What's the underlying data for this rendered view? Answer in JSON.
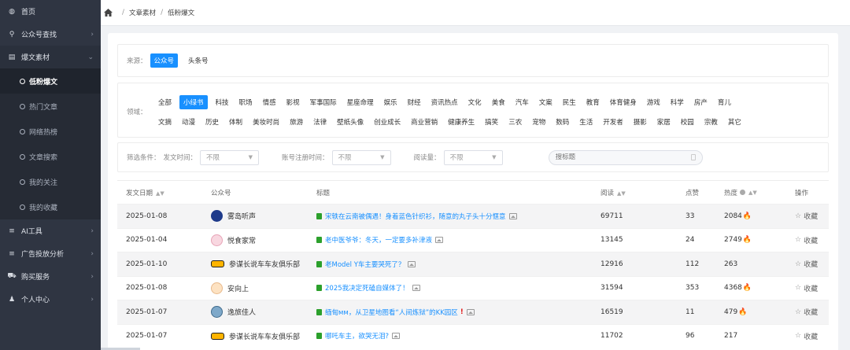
{
  "sidebar": {
    "items": [
      {
        "label": "首页",
        "icon": "dashboard-icon"
      },
      {
        "label": "公众号查找",
        "icon": "search-icon"
      },
      {
        "label": "爆文素材",
        "icon": "document-icon"
      }
    ],
    "submenu": [
      {
        "label": "低粉爆文",
        "active": true
      },
      {
        "label": "热门文章"
      },
      {
        "label": "网络热榜"
      },
      {
        "label": "文章搜索"
      },
      {
        "label": "我的关注"
      },
      {
        "label": "我的收藏"
      }
    ],
    "items_bottom": [
      {
        "label": "AI工具",
        "icon": "list-icon"
      },
      {
        "label": "广告投放分析",
        "icon": "list-icon"
      },
      {
        "label": "购买服务",
        "icon": "cart-icon"
      },
      {
        "label": "个人中心",
        "icon": "user-icon"
      }
    ]
  },
  "breadcrumb": [
    "文章素材",
    "低粉爆文"
  ],
  "source": {
    "label": "来源：",
    "options": [
      "公众号",
      "头条号"
    ],
    "selected": "公众号"
  },
  "domain": {
    "label": "领域：",
    "row1": [
      "全部",
      "小绿书",
      "科技",
      "职场",
      "情感",
      "影视",
      "军事国际",
      "星座命理",
      "娱乐",
      "财经",
      "资讯热点",
      "文化",
      "美食",
      "汽车",
      "文案",
      "民生",
      "教育",
      "体育健身",
      "游戏",
      "科学",
      "房产",
      "育儿"
    ],
    "row2": [
      "文摘",
      "动漫",
      "历史",
      "体制",
      "美妆时尚",
      "旅游",
      "法律",
      "壁纸头像",
      "创业成长",
      "商业营销",
      "健康养生",
      "搞笑",
      "三农",
      "宠物",
      "数码",
      "生活",
      "开发者",
      "摄影",
      "家居",
      "校园",
      "宗教",
      "其它"
    ],
    "selected": "小绿书"
  },
  "filters": {
    "label": "筛选条件：",
    "publish_label": "发文时间：",
    "publish_value": "不限",
    "register_label": "账号注册时间：",
    "register_value": "不限",
    "read_label": "阅读量：",
    "read_value": "不限",
    "search_placeholder": "搜标题"
  },
  "table": {
    "headers": {
      "date": "发文日期",
      "account": "公众号",
      "title": "标题",
      "reads": "阅读",
      "likes": "点赞",
      "heat": "热度",
      "action": "操作"
    },
    "rows": [
      {
        "date": "2025-01-08",
        "account": "雾岛听声",
        "avatar": "blue",
        "title": "宋轶在云南被偶遇！身着蓝色针织衫，随意的丸子头十分惬意",
        "reads": "69711",
        "likes": "33",
        "heat": "2084",
        "fire": true,
        "action": "收藏"
      },
      {
        "date": "2025-01-04",
        "account": "悦食家常",
        "avatar": "pink",
        "title": "老中医爷爷：冬天，一定要多补津液",
        "reads": "13145",
        "likes": "24",
        "heat": "2749",
        "fire": true,
        "action": "收藏"
      },
      {
        "date": "2025-01-10",
        "account": "参谋长说车车友俱乐部",
        "avatar": "car",
        "title": "老Model Y车主要哭死了？",
        "reads": "12916",
        "likes": "112",
        "heat": "263",
        "fire": false,
        "action": "收藏"
      },
      {
        "date": "2025-01-08",
        "account": "安向上",
        "avatar": "person",
        "title": "2025我决定死磕自媒体了！",
        "reads": "31594",
        "likes": "353",
        "heat": "4368",
        "fire": true,
        "action": "收藏"
      },
      {
        "date": "2025-01-07",
        "account": "逸旅佳人",
        "avatar": "planet",
        "title": "缅甸ᴍᴍ，从卫星地图看“人间炼狱”的KK园区",
        "excl": "!",
        "reads": "16519",
        "likes": "11",
        "heat": "479",
        "fire": true,
        "action": "收藏"
      },
      {
        "date": "2025-01-07",
        "account": "参谋长说车车友俱乐部",
        "avatar": "car",
        "title": "哪吒车主，欲哭无泪?",
        "reads": "11702",
        "likes": "96",
        "heat": "217",
        "fire": false,
        "action": "收藏"
      }
    ]
  },
  "colors": {
    "accent": "#1890ff",
    "sidebar": "#2f3542",
    "fire": "#e8541a"
  }
}
